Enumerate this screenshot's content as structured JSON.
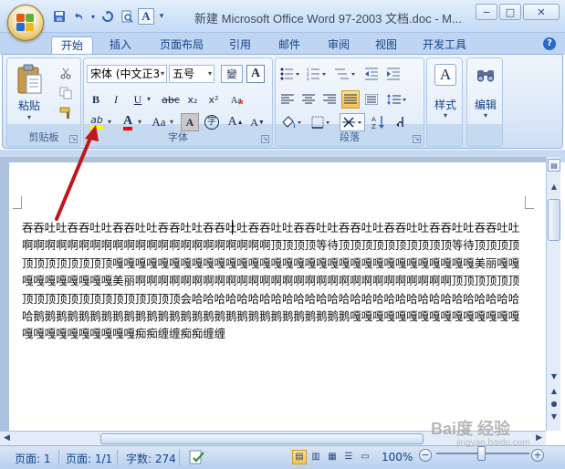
{
  "window": {
    "title": "新建 Microsoft Office Word 97-2003 文档.doc - M...",
    "minimize": "−",
    "maximize": "□",
    "close": "✕"
  },
  "quick_access": {
    "save_icon": "💾",
    "undo_icon": "↶",
    "redo_icon": "↻",
    "preview_icon": "🔍",
    "spell_icon": "A",
    "more_icon": "▾"
  },
  "tabs": [
    "开始",
    "插入",
    "页面布局",
    "引用",
    "邮件",
    "审阅",
    "视图",
    "开发工具"
  ],
  "active_tab": "开始",
  "help_icon": "?",
  "clipboard": {
    "paste_label": "粘贴",
    "group_label": "剪贴板"
  },
  "font": {
    "font_name": "宋体 (中文正3",
    "font_size": "五号",
    "wen_label": "變",
    "a_box": "A",
    "bold": "B",
    "italic": "I",
    "underline": "U",
    "strike": "abc",
    "subscript": "x₂",
    "superscript": "x²",
    "highlight": "ab",
    "font_color": "A",
    "change_case": "Aa",
    "char_shading": "A",
    "enclosed": "字",
    "grow": "A",
    "shrink": "A",
    "group_label": "字体"
  },
  "paragraph": {
    "group_label": "段落"
  },
  "styles": {
    "label": "样式"
  },
  "editing": {
    "label": "编辑"
  },
  "document": {
    "text": "吞吞吐吐吞吞吐吐吞吞吐吐吞吞吐吐吞吞吐吐吞吞吐吐吞吞吐吐吞吞吐吐吞吞吐吐吞吞吐吐吞吞吐吐啊啊啊啊啊啊啊啊啊啊啊啊啊啊啊啊啊啊啊啊啊啊顶顶顶顶等待顶顶顶顶顶顶顶顶顶顶等待顶顶顶顶顶顶顶顶顶顶顶顶嘎嘎嘎嘎嘎嘎嘎嘎嘎嘎嘎嘎嘎嘎嘎嘎嘎嘎嘎嘎嘎嘎嘎嘎嘎嘎嘎嘎嘎嘎嘎嘎美丽嘎嘎嘎嘎嘎嘎嘎嘎嘎嘎美丽啊啊啊啊啊啊啊啊啊啊啊啊啊啊啊啊啊啊啊啊啊啊啊啊啊啊啊啊顶顶顶顶顶顶顶顶顶顶顶顶顶顶顶顶顶顶顶顶会哈哈哈哈哈哈哈哈哈哈哈哈哈哈哈哈哈哈哈哈哈哈哈哈哈哈哈哈哈哈鹅鹅鹅鹅鹅鹅鹅鹅鹅鹅鹅鹅鹅鹅鹅鹅鹅鹅鹅鹅鹅鹅鹅鹅鹅鹅鹅鹅嘎嘎嘎嘎嘎嘎嘎嘎嘎嘎嘎嘎嘎嘎嘎嘎嘎嘎嘎嘎嘎嘎嘎嘎嘎痴痴缠缠痴痴缠缠"
  },
  "status": {
    "page": "页面: 1",
    "pages": "页面: 1/1",
    "words": "字数: 274",
    "zoom": "100%",
    "zoom_out": "−",
    "zoom_in": "+"
  },
  "watermark": {
    "brand": "Bai度 经验",
    "url": "jingyan.baidu.com"
  },
  "colors": {
    "annotation_arrow": "#c0161c",
    "highlight_yellow": "#ffff00",
    "font_color_red": "#ff0000"
  }
}
